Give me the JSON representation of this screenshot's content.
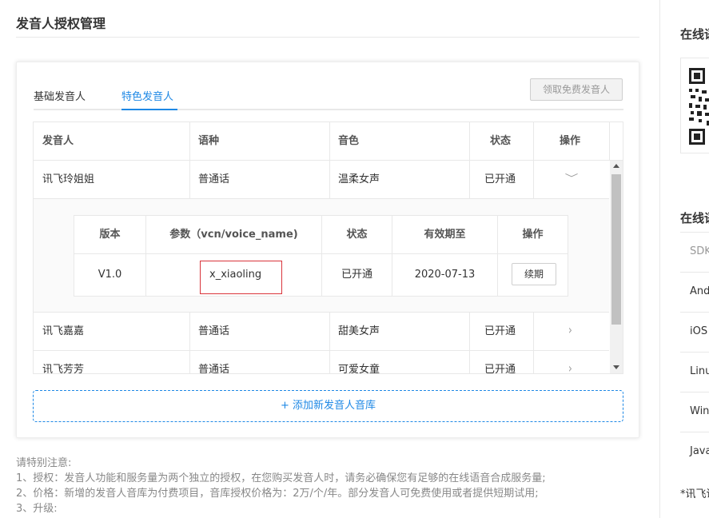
{
  "page": {
    "title": "发音人授权管理"
  },
  "tabs": {
    "basic": "基础发音人",
    "special": "特色发音人",
    "free_button": "领取免费发音人"
  },
  "table": {
    "headers": {
      "speaker": "发音人",
      "language": "语种",
      "timbre": "音色",
      "status": "状态",
      "action": "操作"
    },
    "rows": [
      {
        "speaker": "讯飞玲姐姐",
        "language": "普通话",
        "timbre": "温柔女声",
        "status": "已开通"
      },
      {
        "speaker": "讯飞嘉嘉",
        "language": "普通话",
        "timbre": "甜美女声",
        "status": "已开通"
      },
      {
        "speaker": "讯飞芳芳",
        "language": "普通话",
        "timbre": "可爱女童",
        "status": "已开通"
      }
    ],
    "detail": {
      "headers": {
        "version": "版本",
        "param": "参数（vcn/voice_name)",
        "status": "状态",
        "expire": "有效期至",
        "action": "操作"
      },
      "row": {
        "version": "V1.0",
        "param": "x_xiaoling",
        "status": "已开通",
        "expire": "2020-07-13",
        "renew": "续期"
      }
    }
  },
  "add_button": "+ 添加新发音人音库",
  "notes": [
    "请特别注意:",
    "1、授权：发音人功能和服务量为两个独立的授权，在您购买发音人时，请务必确保您有足够的在线语音合成服务量;",
    "2、价格：新增的发音人音库为付费项目，音库授权价格为：2万/个/年。部分发音人可免费使用或者提供短期试用;",
    "3、升级:"
  ],
  "sidebar": {
    "title1": "在线语",
    "title2": "在线语",
    "sdk_items": [
      "SDK",
      "Android",
      "iOS",
      "Linux",
      "Windows",
      "Java"
    ],
    "footnote": "*讯飞语"
  },
  "colors": {
    "accent": "#1e88e5",
    "highlight_border": "#d9343b"
  }
}
